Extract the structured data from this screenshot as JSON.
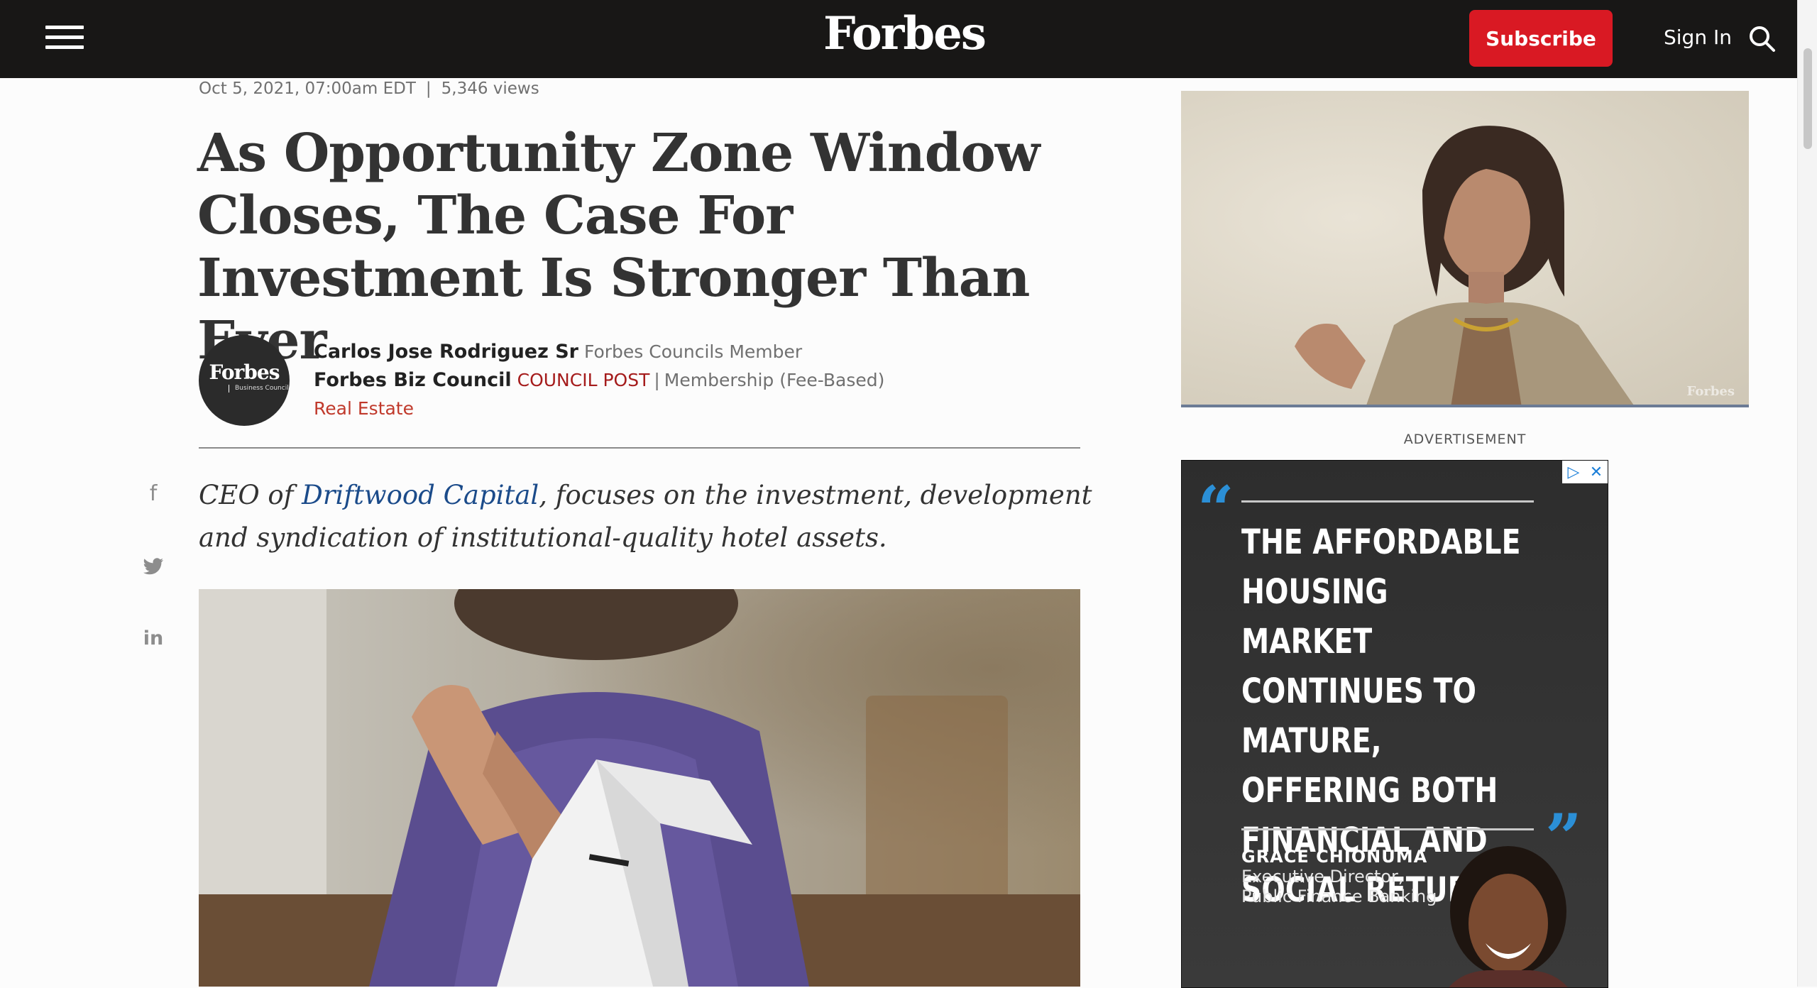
{
  "header": {
    "brand": "Forbes",
    "subscribe_label": "Subscribe",
    "signin_label": "Sign In"
  },
  "article": {
    "date": "Oct 5, 2021, 07:00am EDT",
    "separator": "|",
    "views": "5,346 views",
    "title": "As Opportunity Zone Window Closes, The Case For Investment Is Stronger Than Ever",
    "avatar_logo": "Forbes",
    "avatar_sub": "Business Council",
    "author_name": "Carlos Jose Rodriguez Sr",
    "author_role": "Forbes Councils Member",
    "council_name": "Forbes Biz Council",
    "council_post": "COUNCIL POST",
    "membership": "Membership (Fee-Based)",
    "category": "Real Estate",
    "bio_prefix": "CEO of ",
    "bio_link": "Driftwood Capital",
    "bio_suffix": ", focuses on the investment, development and syndication of institutional-quality hotel assets."
  },
  "share": {
    "facebook_glyph": "f",
    "linkedin_glyph": "in"
  },
  "sidebar": {
    "video_watermark": "Forbes",
    "ad_label": "ADVERTISEMENT",
    "ad_quote": "THE AFFORDABLE HOUSING MARKET CONTINUES TO MATURE, OFFERING BOTH FINANCIAL AND SOCIAL RETURN.",
    "ad_person_name": "GRACE CHIONUMA",
    "ad_person_title_1": "Executive Director,",
    "ad_person_title_2": "Public Finance Banking"
  },
  "colors": {
    "header_bg": "#181716",
    "subscribe": "#d91923",
    "link": "#1b4b8a",
    "council_post": "#a51c1c",
    "category": "#c0392b",
    "ad_accent": "#2b8fd6"
  }
}
